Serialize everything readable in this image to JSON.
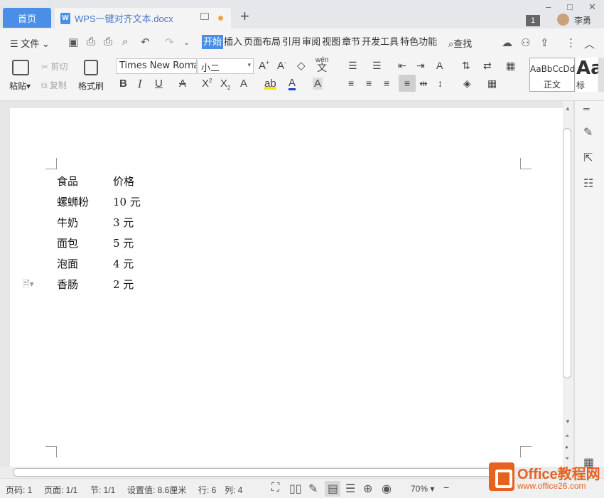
{
  "tabs": {
    "home": "首页",
    "doc_title": "WPS一键对齐文本.docx",
    "doc_icon": "W"
  },
  "account": {
    "badge": "1",
    "username": "李勇"
  },
  "menu": {
    "file": "文件",
    "items": [
      "开始",
      "插入",
      "页面布局",
      "引用",
      "审阅",
      "视图",
      "章节",
      "开发工具",
      "特色功能"
    ],
    "search": "查找"
  },
  "ribbon": {
    "paste": "粘贴",
    "cut": "剪切",
    "copy": "复制",
    "format_painter": "格式刷",
    "font_name": "Times New Roman",
    "font_size": "小二",
    "pinyin": "wén",
    "style_sample": "AaBbCcDd",
    "style_name": "正文",
    "style2_sample": "Aa",
    "style2_name": "标"
  },
  "document": {
    "rows": [
      [
        "食品",
        "价格"
      ],
      [
        "螺蛳粉",
        "10 元"
      ],
      [
        "牛奶",
        "3 元"
      ],
      [
        "面包",
        "5 元"
      ],
      [
        "泡面",
        "4 元"
      ],
      [
        "香肠",
        "2 元"
      ]
    ]
  },
  "status": {
    "page_num": "页码: 1",
    "pages": "页面: 1/1",
    "section": "节: 1/1",
    "setting": "设置值: 8.6厘米",
    "row": "行: 6",
    "col": "列: 4",
    "zoom": "70%"
  },
  "watermark": {
    "title": "Office教程网",
    "url": "www.office26.com"
  }
}
